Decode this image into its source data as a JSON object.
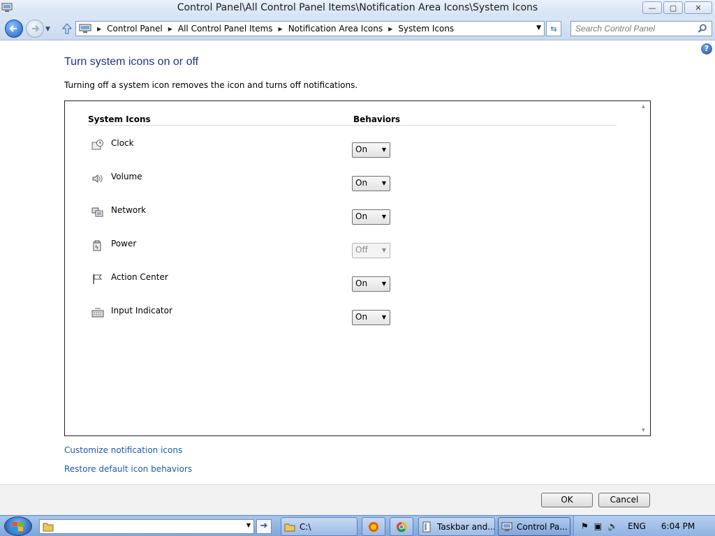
{
  "window": {
    "title": "Control Panel\\All Control Panel Items\\Notification Area Icons\\System Icons",
    "minimize": "—",
    "maximize": "▢",
    "close": "✕"
  },
  "nav": {
    "breadcrumbs": [
      "Control Panel",
      "All Control Panel Items",
      "Notification Area Icons",
      "System Icons"
    ],
    "search_placeholder": "Search Control Panel"
  },
  "page": {
    "heading": "Turn system icons on or off",
    "description": "Turning off a system icon removes the icon and turns off notifications.",
    "help_label": "?"
  },
  "table": {
    "col_icons": "System Icons",
    "col_behaviors": "Behaviors",
    "rows": [
      {
        "name": "Clock",
        "value": "On",
        "enabled": true,
        "icon": "clock-icon"
      },
      {
        "name": "Volume",
        "value": "On",
        "enabled": true,
        "icon": "volume-icon"
      },
      {
        "name": "Network",
        "value": "On",
        "enabled": true,
        "icon": "network-icon"
      },
      {
        "name": "Power",
        "value": "Off",
        "enabled": false,
        "icon": "power-icon"
      },
      {
        "name": "Action Center",
        "value": "On",
        "enabled": true,
        "icon": "flag-icon"
      },
      {
        "name": "Input Indicator",
        "value": "On",
        "enabled": true,
        "icon": "keyboard-icon"
      }
    ]
  },
  "links": {
    "customize": "Customize notification icons",
    "restore": "Restore default icon behaviors"
  },
  "buttons": {
    "ok": "OK",
    "cancel": "Cancel"
  },
  "taskbar": {
    "run_arrow": "➔",
    "items": [
      {
        "label": "C:\\"
      },
      {
        "label": "Taskbar and..."
      },
      {
        "label": "Control Pa..."
      }
    ],
    "tray": {
      "language": "ENG",
      "time": "6:04 PM"
    }
  },
  "colors": {
    "heading": "#1e3287",
    "link": "#1e5aa8",
    "taskbar": "#7ea6da"
  }
}
